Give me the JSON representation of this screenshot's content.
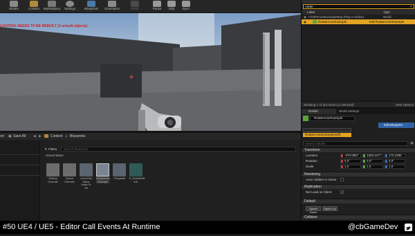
{
  "toolbar": {
    "items": [
      "Modes",
      "Content",
      "Marketplace",
      "Settings",
      "Blueprints",
      "Cinematics",
      "Build",
      "Pause",
      "Skip",
      "Eject"
    ]
  },
  "viewport": {
    "error_message": "LIGHTING NEEDS TO BE REBUILT (3 unbuilt objects)",
    "error_color": "#d02020"
  },
  "world_outliner": {
    "search_value": "rotate",
    "columns": {
      "label": "Label",
      "type": "Type"
    },
    "rows": [
      {
        "label": "FirstPersonExampleMap (Play In Editor)",
        "type": "World"
      },
      {
        "label": "RotateActorExample",
        "type": "Edit RotateActorExample"
      }
    ],
    "status": "Showing 1 of 112 actors (1 selected)",
    "view_options": "View Options"
  },
  "details_panel": {
    "tabs": {
      "details": "Details",
      "world_settings": "World Settings"
    },
    "actor_name": "RotateActorExample",
    "component_root": "RotateActorExample(self)",
    "edit_blueprint": "Edit Blueprint",
    "search_placeholder": "Search Details",
    "sections": {
      "transform": "Transform",
      "rendering": "Rendering",
      "replication": "Replication",
      "default": "Default",
      "collision": "Collision"
    },
    "location": {
      "label": "Location",
      "x": "-570.0887",
      "y": "1353.4477",
      "z": "170.2396"
    },
    "rotation": {
      "label": "Rotation",
      "x": "0.0°",
      "y": "0.0°",
      "z": "0.0°"
    },
    "scale": {
      "label": "Scale",
      "x": "1.0",
      "y": "1.0",
      "z": "1.0"
    },
    "actor_hidden_label": "Actor Hidden In Game",
    "net_load_label": "Net Load on Client",
    "buttons": {
      "speed_down": "Speed Down",
      "speed_up": "Speed Up"
    }
  },
  "content_browser": {
    "left_path": "ort",
    "save_all": "Save All",
    "breadcrumb": [
      "Content",
      "Blueprints"
    ],
    "filters_label": "Filters",
    "search_placeholder": "Search Blueprints",
    "sound_wave_label": "Sound Wave",
    "assets": [
      {
        "name": "Drifting Override",
        "color": "#7a6a4a"
      },
      {
        "name": "Speed Override",
        "color": "#7a6a4a"
      },
      {
        "name": "ActorThat Starts Head To Tilt",
        "color": "#4a5866"
      },
      {
        "name": "RotateActor Example",
        "color": "#4a5866"
      },
      {
        "name": "CRapidde",
        "color": "#4a5866"
      },
      {
        "name": "E_RotateEdit Info",
        "color": "#2f5a58"
      }
    ]
  },
  "footer": {
    "title": "#50 UE4 / UE5 - Editor Call Events At Runtime",
    "handle": "@cbGameDev"
  }
}
